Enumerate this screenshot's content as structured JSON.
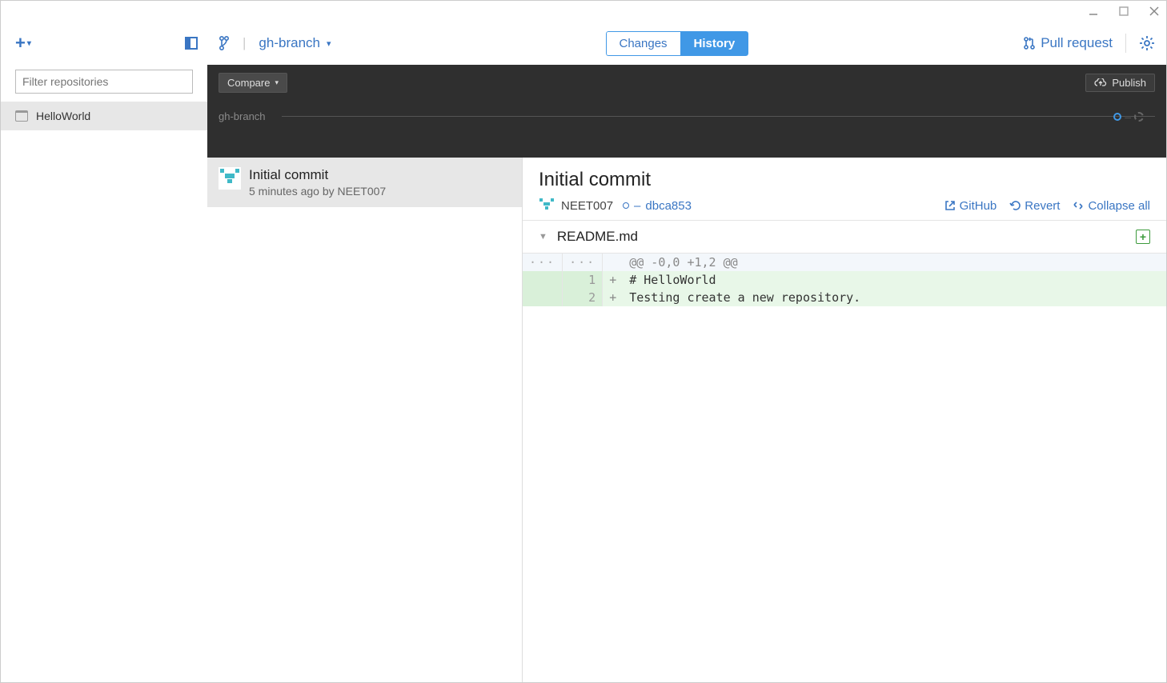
{
  "sidebar": {
    "filter_placeholder": "Filter repositories",
    "repo_name": "HelloWorld"
  },
  "topbar": {
    "branch_name": "gh-branch",
    "tabs": {
      "changes": "Changes",
      "history": "History"
    },
    "pull_request": "Pull request"
  },
  "darkbar": {
    "compare": "Compare",
    "publish": "Publish",
    "branch_label": "gh-branch"
  },
  "commit_list": {
    "title": "Initial commit",
    "meta": "5 minutes ago by NEET007"
  },
  "diff": {
    "title": "Initial commit",
    "author": "NEET007",
    "sha": "dbca853",
    "actions": {
      "github": "GitHub",
      "revert": "Revert",
      "collapse": "Collapse all"
    },
    "file": "README.md",
    "hunk": "@@ -0,0 +1,2 @@",
    "lines": [
      {
        "ln": "1",
        "text": "# HelloWorld"
      },
      {
        "ln": "2",
        "text": "Testing create a new repository."
      }
    ]
  }
}
